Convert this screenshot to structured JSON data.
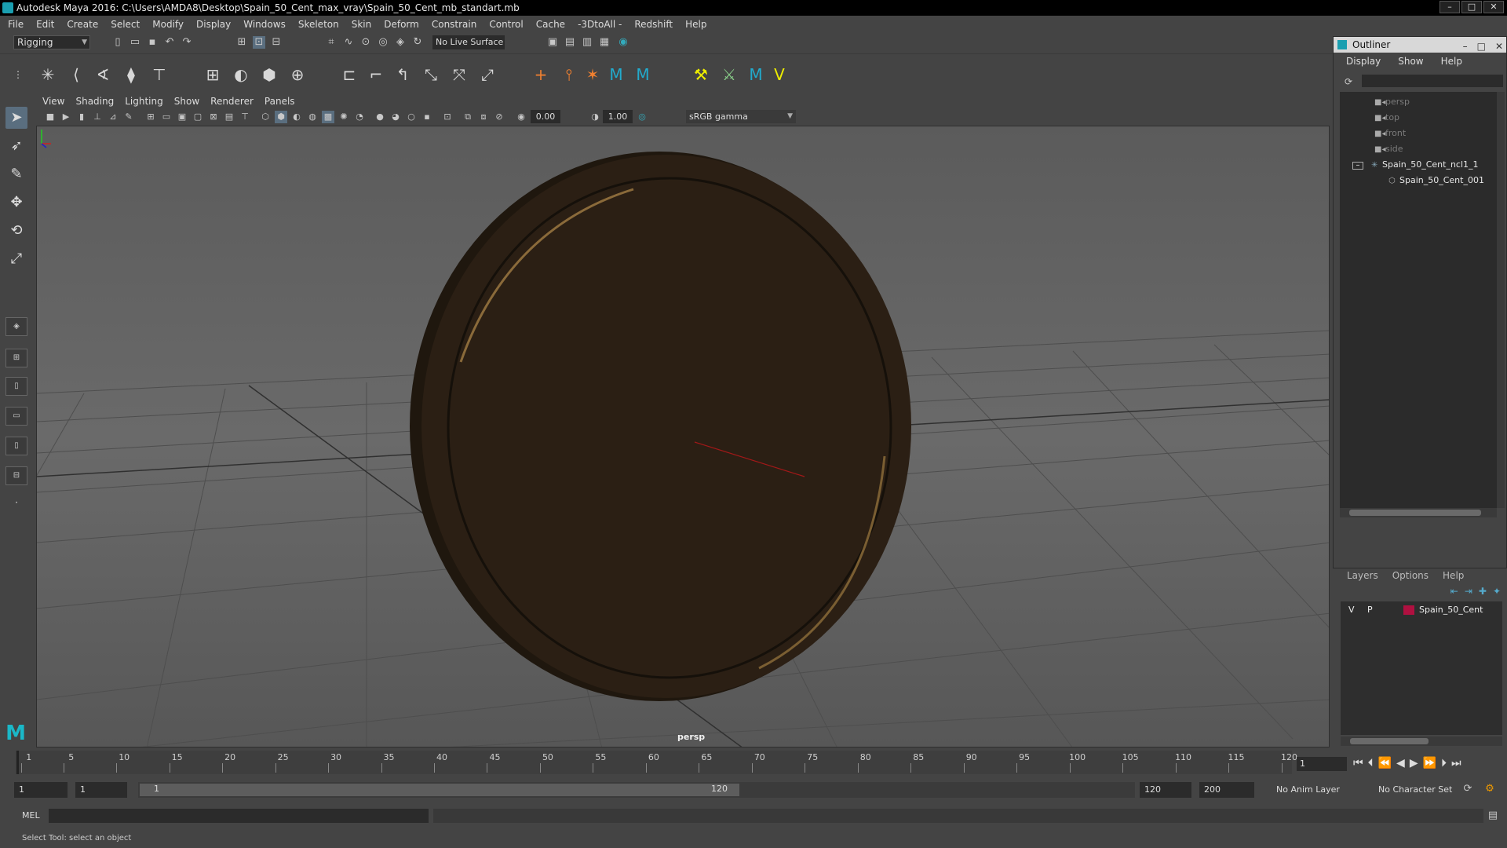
{
  "window": {
    "title": "Autodesk Maya 2016: C:\\Users\\AMDA8\\Desktop\\Spain_50_Cent_max_vray\\Spain_50_Cent_mb_standart.mb",
    "min_icon": "minimize-icon",
    "max_icon": "maximize-icon",
    "close_icon": "close-icon"
  },
  "menubar": [
    "File",
    "Edit",
    "Create",
    "Select",
    "Modify",
    "Display",
    "Windows",
    "Skeleton",
    "Skin",
    "Deform",
    "Constrain",
    "Control",
    "Cache",
    "-3DtoAll -",
    "Redshift",
    "Help"
  ],
  "toolbar": {
    "mode": "Rigging",
    "live_surface": "No Live Surface"
  },
  "panel": {
    "menu": [
      "View",
      "Shading",
      "Lighting",
      "Show",
      "Renderer",
      "Panels"
    ],
    "exposure": "0.00",
    "gamma": "1.00",
    "color_space": "sRGB gamma",
    "camera_label": "persp"
  },
  "outliner": {
    "title": "Outliner",
    "menu": [
      "Display",
      "Show",
      "Help"
    ],
    "items": [
      {
        "label": "persp",
        "type": "camera",
        "dim": true
      },
      {
        "label": "top",
        "type": "camera",
        "dim": true
      },
      {
        "label": "front",
        "type": "camera",
        "dim": true
      },
      {
        "label": "side",
        "type": "camera",
        "dim": true
      },
      {
        "label": "Spain_50_Cent_ncl1_1",
        "type": "group",
        "dim": false
      },
      {
        "label": "Spain_50_Cent_001",
        "type": "mesh",
        "dim": false
      }
    ]
  },
  "layers": {
    "menu": [
      "Layers",
      "Options",
      "Help"
    ],
    "rows": [
      {
        "v": "V",
        "p": "P",
        "name": "Spain_50_Cent",
        "color": "#b01040"
      }
    ]
  },
  "timeline": {
    "ticks": [
      1,
      5,
      10,
      15,
      20,
      25,
      30,
      35,
      40,
      45,
      50,
      55,
      60,
      65,
      70,
      75,
      80,
      85,
      90,
      95,
      100,
      105,
      110,
      115,
      120
    ],
    "current_frame": "1"
  },
  "range": {
    "start": "1",
    "anim_start": "1",
    "slider_start": "1",
    "slider_end": "120",
    "anim_end": "120",
    "end": "200",
    "anim_layer": "No Anim Layer",
    "char_set": "No Character Set"
  },
  "cmdline": {
    "label": "MEL"
  },
  "helpline": {
    "text": "Select Tool: select an object"
  },
  "colors": {
    "accent": "#1a9fb0",
    "coin": "#2b1f14",
    "layer_color": "#b01040"
  }
}
